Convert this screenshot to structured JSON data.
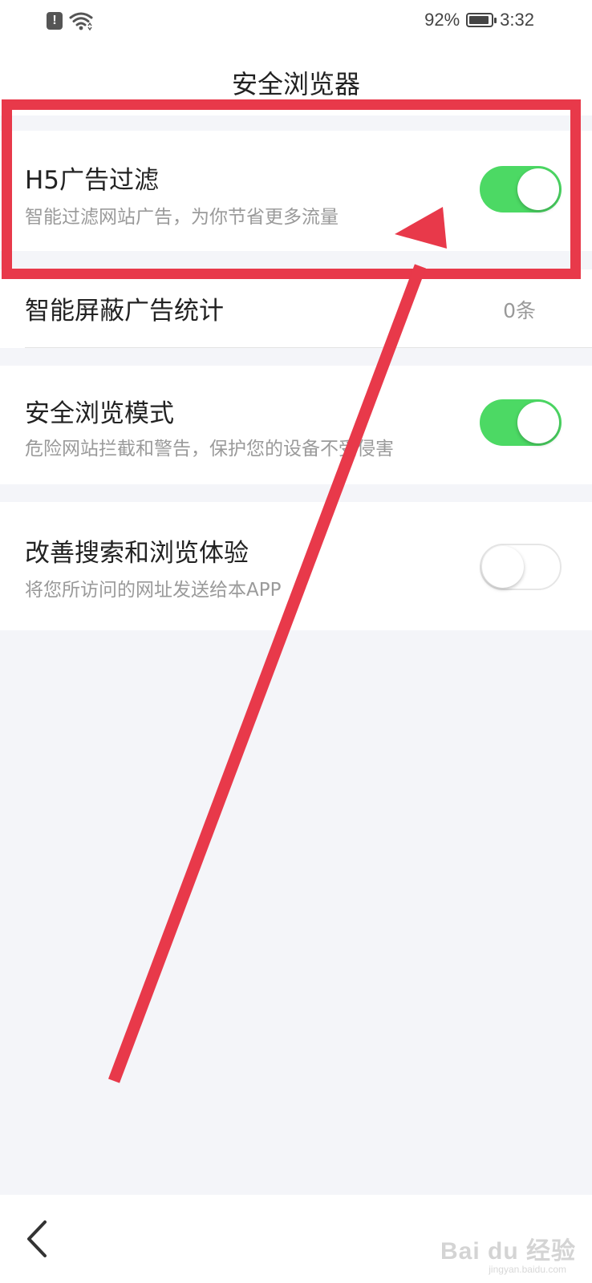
{
  "status_bar": {
    "battery_percent_text": "92%",
    "battery_level": 0.92,
    "time": "3:32",
    "icons": [
      "alert-icon",
      "wifi-icon",
      "battery-icon"
    ]
  },
  "header": {
    "title": "安全浏览器"
  },
  "settings": [
    {
      "title": "H5广告过滤",
      "subtitle": "智能过滤网站广告，为你节省更多流量",
      "toggle": true
    },
    {
      "title": "智能屏蔽广告统计",
      "value": "0条"
    },
    {
      "title": "安全浏览模式",
      "subtitle": "危险网站拦截和警告，保护您的设备不受侵害",
      "toggle": true
    },
    {
      "title": "改善搜索和浏览体验",
      "subtitle": "将您所访问的网址发送给本APP",
      "toggle": false
    }
  ],
  "bottom_bar": {
    "back_icon": "chevron-left-icon"
  },
  "watermark": {
    "brand": "Bai du 经验",
    "url": "jingyan.baidu.com"
  },
  "colors": {
    "toggle_on": "#4cd964",
    "annotation_red": "#e8394a",
    "page_background": "#f4f5f9"
  }
}
